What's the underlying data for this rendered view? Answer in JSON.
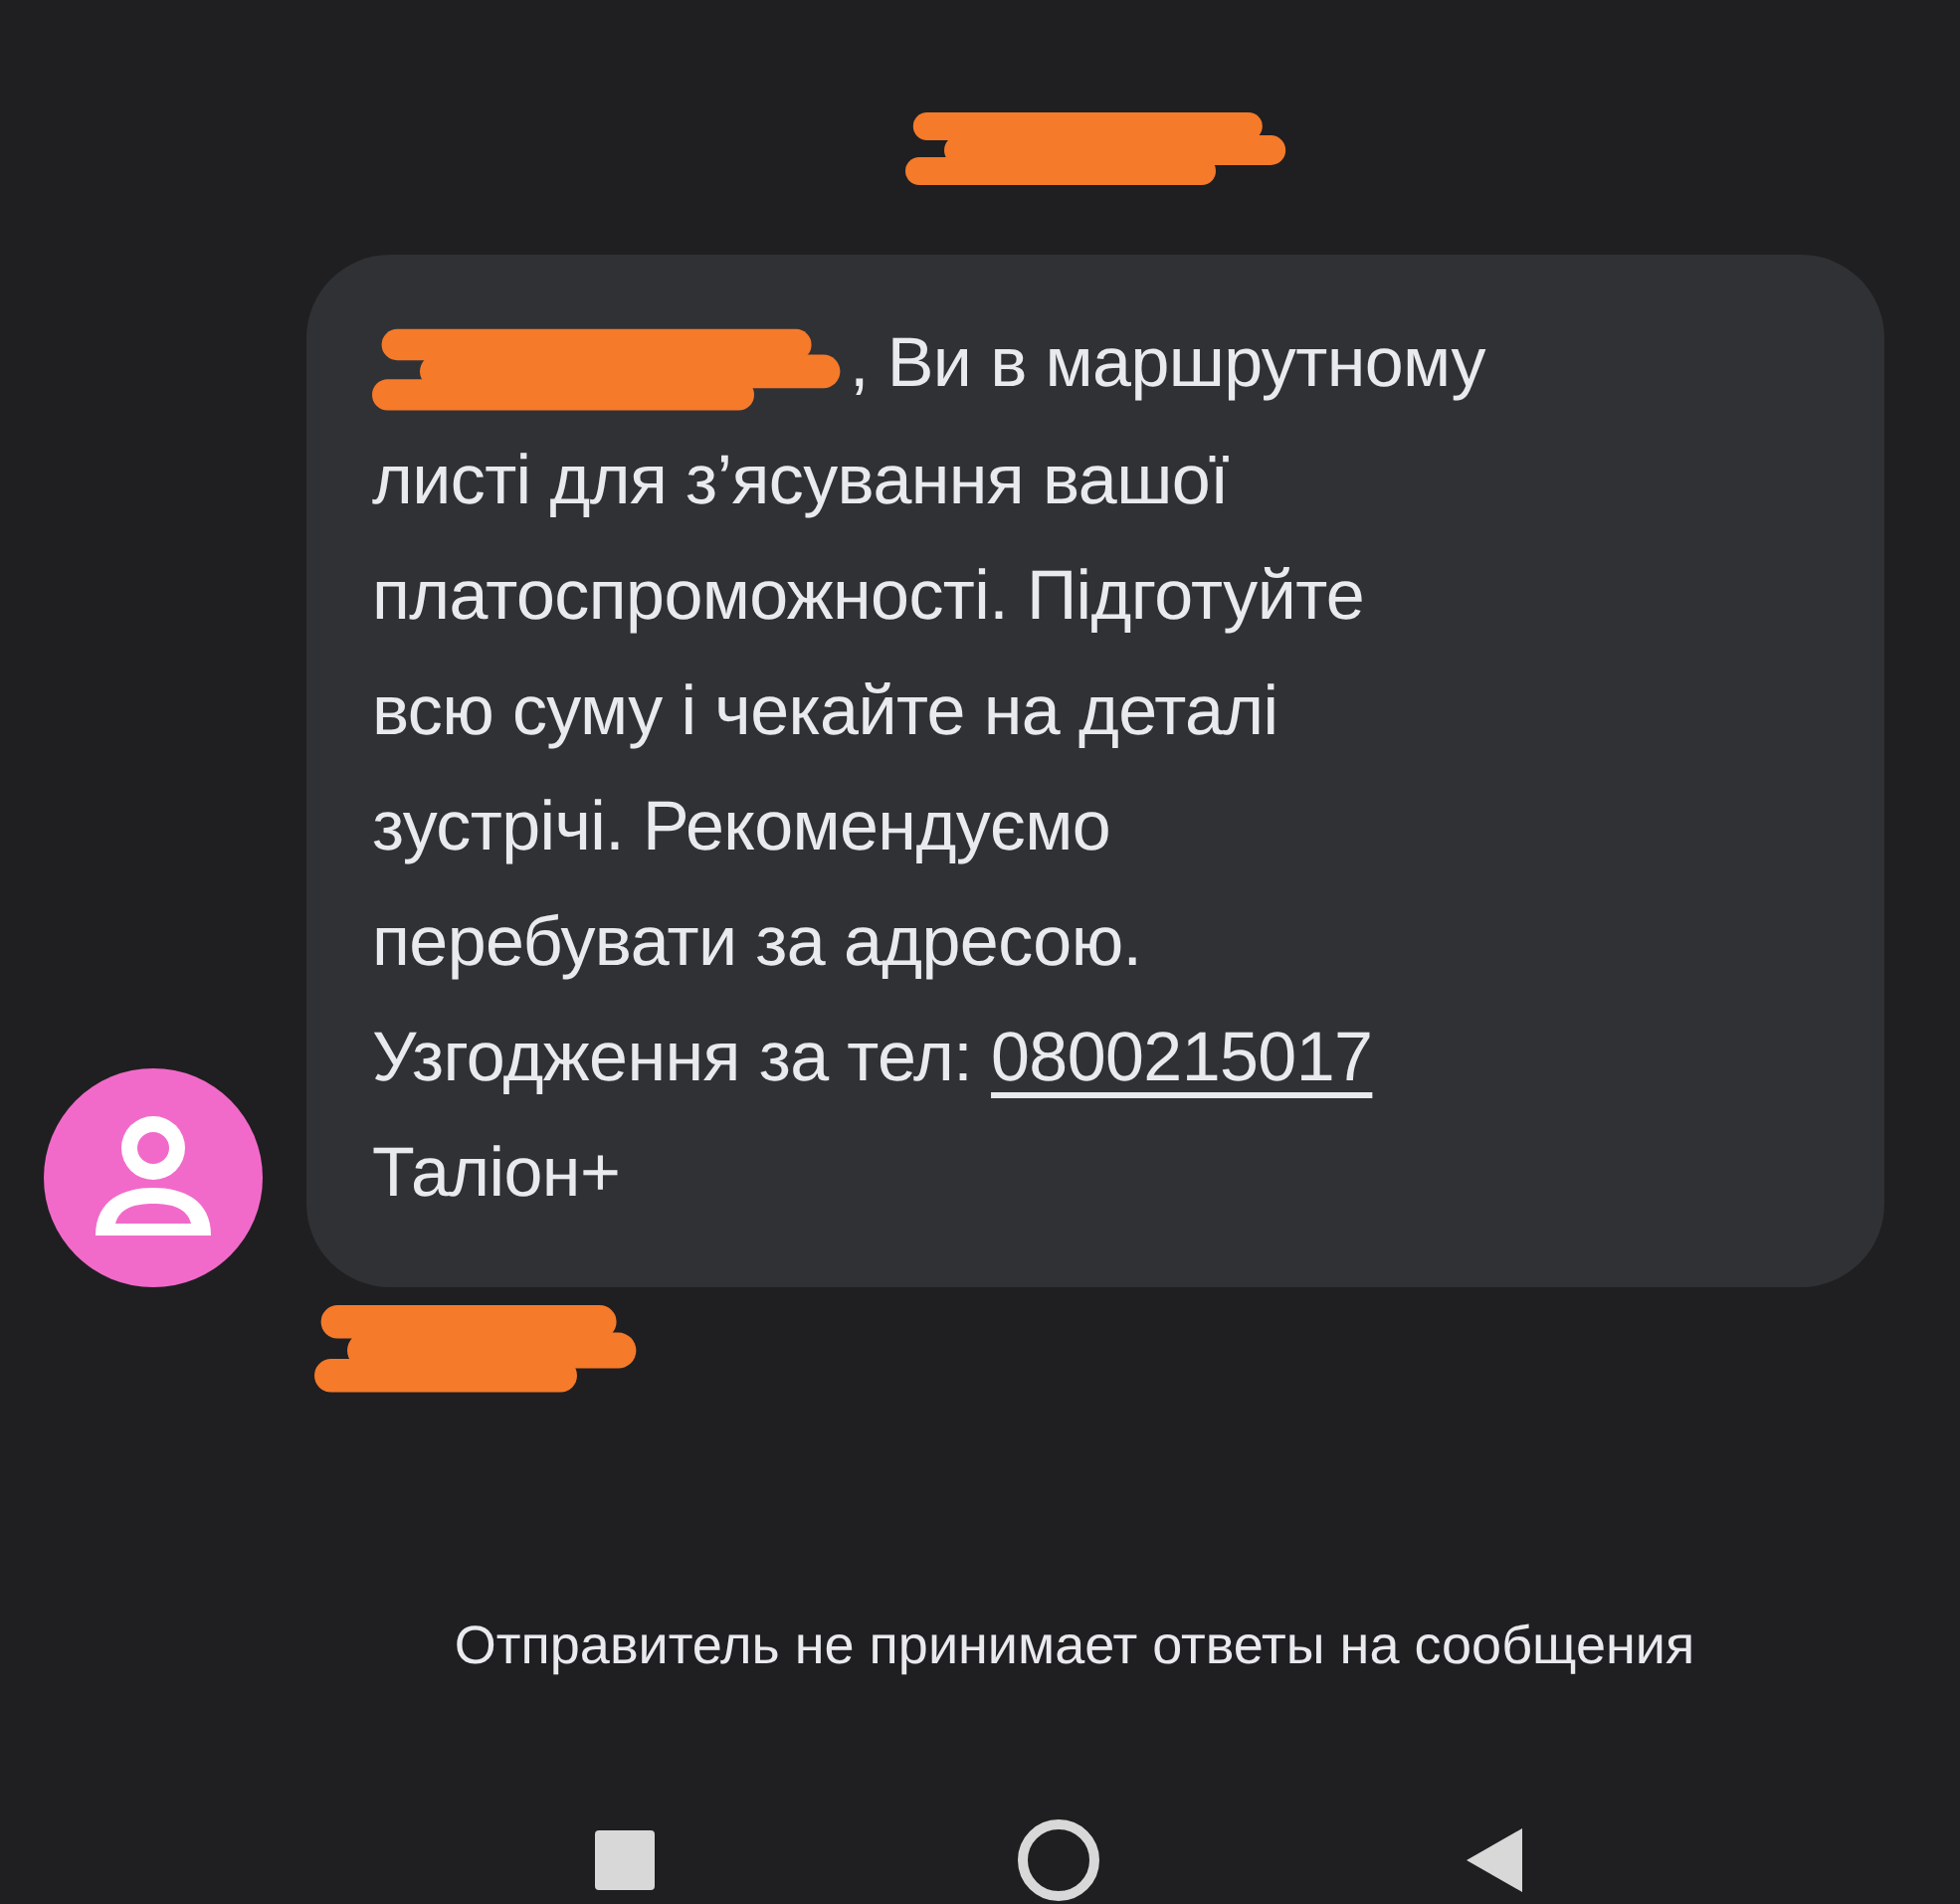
{
  "message": {
    "lines": [
      ", Ви в маршрутному",
      "листі для з’ясування вашої",
      "платоспроможності. Підготуйте",
      "всю суму і чекайте на деталі",
      "зустрічі. Рекомендуємо",
      "перебувати за адресою."
    ],
    "phone_label": "Узгодження за тел:",
    "phone": "0800215017",
    "signature": "Таліон+"
  },
  "notice": "Отправитель не принимает ответы на сообщения"
}
